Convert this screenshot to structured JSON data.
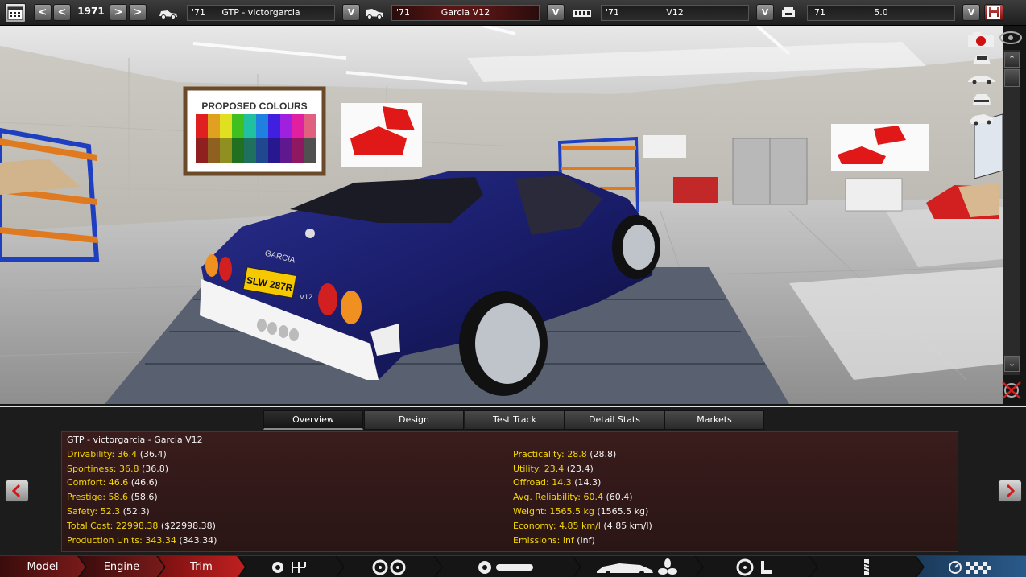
{
  "topbar": {
    "year": "1971",
    "model_field": {
      "year": "'71",
      "name": "GTP - victorgarcia"
    },
    "trim_field": {
      "year": "'71",
      "name": "Garcia V12"
    },
    "engine_field": {
      "year": "'71",
      "name": "V12"
    },
    "variant_field": {
      "year": "'71",
      "name": "5.0"
    },
    "prev_label": "<",
    "next_label": ">",
    "dropdown_label": "V"
  },
  "scene": {
    "poster_title": "PROPOSED COLOURS",
    "car_badge": "GARCIA",
    "car_plate": "SLW 287R",
    "car_script": "V12"
  },
  "side_icons": [
    "camera-icon",
    "car-front-icon",
    "car-side-icon",
    "car-rear-icon",
    "car-angled-icon"
  ],
  "tabs": [
    {
      "label": "Overview",
      "active": true
    },
    {
      "label": "Design",
      "active": false
    },
    {
      "label": "Test Track",
      "active": false
    },
    {
      "label": "Detail Stats",
      "active": false
    },
    {
      "label": "Markets",
      "active": false
    }
  ],
  "stats": {
    "header": "GTP - victorgarcia - Garcia V12",
    "left": [
      {
        "label": "Drivability:",
        "value": "36.4",
        "base": "(36.4)"
      },
      {
        "label": "Sportiness:",
        "value": "36.8",
        "base": "(36.8)"
      },
      {
        "label": "Comfort:",
        "value": "46.6",
        "base": "(46.6)"
      },
      {
        "label": "Prestige:",
        "value": "58.6",
        "base": "(58.6)"
      },
      {
        "label": "Safety:",
        "value": "52.3",
        "base": "(52.3)"
      },
      {
        "label": "Total Cost:",
        "value": "22998.38",
        "base": "($22998.38)"
      },
      {
        "label": "Production Units:",
        "value": "343.34",
        "base": "(343.34)"
      }
    ],
    "right": [
      {
        "label": "Practicality:",
        "value": "28.8",
        "base": "(28.8)"
      },
      {
        "label": "Utility:",
        "value": "23.4",
        "base": "(23.4)"
      },
      {
        "label": "Offroad:",
        "value": "14.3",
        "base": "(14.3)"
      },
      {
        "label": "Avg. Reliability:",
        "value": "60.4",
        "base": "(60.4)"
      },
      {
        "label": "Weight:",
        "value": "1565.5 kg",
        "base": "(1565.5 kg)"
      },
      {
        "label": "Economy:",
        "value": "4.85 km/l",
        "base": "(4.85 km/l)"
      },
      {
        "label": "Emissions:",
        "value": "inf",
        "base": "(inf)"
      }
    ]
  },
  "nav": [
    {
      "label": "Model"
    },
    {
      "label": "Engine"
    },
    {
      "label": "Trim"
    }
  ],
  "nav_icons": [
    "gearbox-icon",
    "wheels-icon",
    "brakes-icon",
    "aero-icon",
    "interior-icon",
    "suspension-icon",
    "finish-icon"
  ],
  "colors": {
    "accent_red": "#8a1e1e",
    "stat_yellow": "#f5d800",
    "nav_blue": "#2a5a8a"
  }
}
